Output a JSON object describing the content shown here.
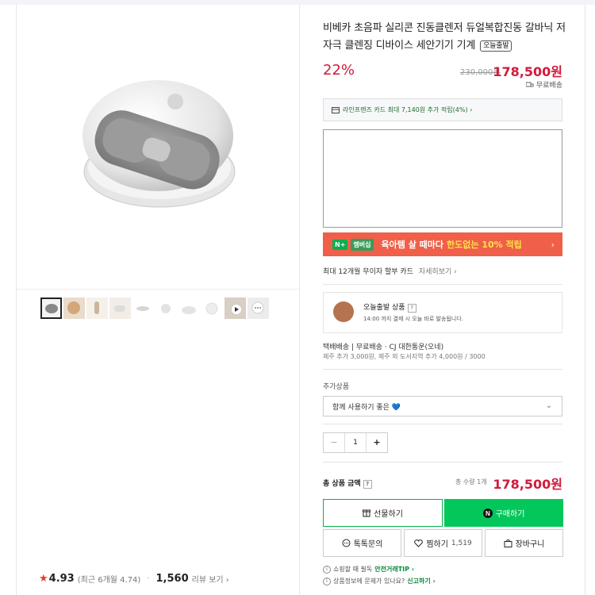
{
  "product": {
    "title": "비베카 초음파 실리콘 진동클렌저 듀얼복합진동 갈바닉 저자극 클렌징 디바이스 세안기기 기계",
    "badge": "오늘출발",
    "discount": "22%",
    "original_price": "230,000원",
    "price": "178,500원",
    "shipping": "무료배송"
  },
  "card_promo": {
    "text": "라인프렌즈 카드 최대 7,140원 추가 적립(4%) ›"
  },
  "banner": {
    "logo": "N+",
    "logo2": "멤버십",
    "text": "육아템 살 때마다",
    "highlight": "한도없는 10% 적립",
    "arrow": "›"
  },
  "installment": {
    "text": "최대 12개월 무이자 할부 카드",
    "more": "자세히보기 ›"
  },
  "today_ship": {
    "title": "오늘출발 상품",
    "help": "?",
    "desc": "14:00 까지 결제 시 오늘 바로 발송됩니다."
  },
  "delivery": {
    "line1": "택배배송  |  무료배송 · CJ 대한통운(오네)",
    "line2": "제주 추가 3,000원, 제주 외 도서지역 추가 4,000원 / 3000"
  },
  "addon": {
    "label": "추가상품",
    "select_value": "함께 사용하기 좋은 💙"
  },
  "quantity": {
    "minus": "−",
    "value": "1",
    "plus": "+"
  },
  "total": {
    "label": "총 상품 금액",
    "help": "?",
    "qty": "총 수량 1개",
    "price": "178,500원"
  },
  "buttons": {
    "gift": "선물하기",
    "buy": "구매하기",
    "talk": "톡톡문의",
    "wish": "찜하기",
    "wish_count": "1,519",
    "cart": "장바구니"
  },
  "tips": {
    "tip1": "쇼핑할 때 필독",
    "tip1_link": "안전거래TIP ›",
    "tip2": "상품정보에 문제가 있나요?",
    "tip2_link": "신고하기 ›"
  },
  "rating": {
    "score": "4.93",
    "recent": "(최근 6개월 4.74)",
    "count": "1,560",
    "link": "리뷰 보기 ›"
  },
  "thumbnails": [
    "thumb-1",
    "thumb-2",
    "thumb-3",
    "thumb-4",
    "thumb-5",
    "thumb-6",
    "thumb-7",
    "thumb-8",
    "thumb-9",
    "thumb-10"
  ],
  "colors": {
    "price": "#d11a3a",
    "green": "#03c75a",
    "banner": "#ef5f49"
  }
}
